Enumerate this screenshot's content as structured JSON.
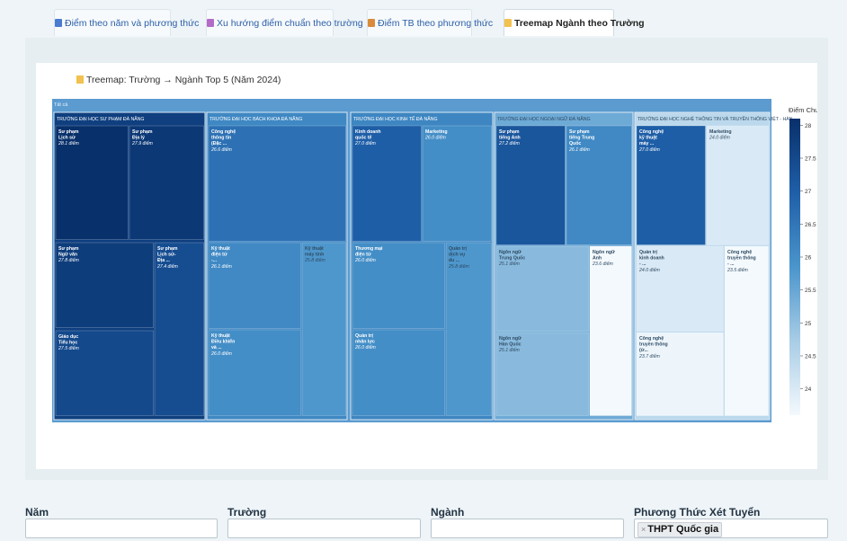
{
  "tabs": [
    {
      "label": "Điểm theo năm và phương thức",
      "icon": "calendar-icon",
      "color": "#4a7bd0"
    },
    {
      "label": "Xu hướng điểm chuẩn theo trường",
      "icon": "trend-chart-icon",
      "color": "#b46bc8"
    },
    {
      "label": "Điểm TB theo phương thức",
      "icon": "bar-chart-icon",
      "color": "#d98a3a"
    },
    {
      "label": "Treemap Ngành theo Trường",
      "icon": "folder-icon",
      "color": "#f2c14e"
    }
  ],
  "active_tab": 3,
  "chart_title": "Treemap: Trường → Ngành Top 5 (Năm 2024)",
  "chart_data": {
    "type": "treemap",
    "root_label": "Tất cả",
    "value_label": "Điểm Chuẩn",
    "colorbar": {
      "min": 23.6,
      "max": 28.1,
      "ticks": [
        28,
        27.5,
        27,
        26.5,
        26,
        25.5,
        25,
        24.5,
        24
      ]
    },
    "unit_suffix": "điểm",
    "schools": [
      {
        "name": "TRƯỜNG ĐẠI HỌC SƯ PHẠM ĐÀ NẴNG",
        "majors": [
          {
            "lines": [
              "Sư phạm",
              "Lịch sử"
            ],
            "value": 28.1
          },
          {
            "lines": [
              "Sư phạm",
              "Địa lý"
            ],
            "value": 27.9
          },
          {
            "lines": [
              "Sư phạm",
              "Ngữ văn"
            ],
            "value": 27.8
          },
          {
            "lines": [
              "Sư phạm",
              "Lịch sử-",
              "Địa ..."
            ],
            "value": 27.4
          },
          {
            "lines": [
              "Giáo dục",
              "Tiểu học"
            ],
            "value": 27.5
          }
        ]
      },
      {
        "name": "TRƯỜNG ĐẠI HỌC BÁCH KHOA ĐÀ NẴNG",
        "majors": [
          {
            "lines": [
              "Công nghệ",
              "thông tin",
              "(Đặc ..."
            ],
            "value": 26.6
          },
          {
            "lines": [
              "Kỹ thuật",
              "điện tử",
              "-..."
            ],
            "value": 26.1
          },
          {
            "lines": [
              "Kỹ thuật",
              "máy tính"
            ],
            "value": 25.8
          },
          {
            "lines": [
              "Kỹ thuật",
              "Điều khiển",
              "và ..."
            ],
            "value": 26.0
          }
        ]
      },
      {
        "name": "TRƯỜNG ĐẠI HỌC KINH TẾ ĐÀ NẴNG",
        "majors": [
          {
            "lines": [
              "Kinh doanh",
              "quốc tế"
            ],
            "value": 27.0
          },
          {
            "lines": [
              "Marketing"
            ],
            "value": 26.0
          },
          {
            "lines": [
              "Thương mại",
              "điện tử"
            ],
            "value": 26.0
          },
          {
            "lines": [
              "Quản trị",
              "dịch vụ",
              "du ..."
            ],
            "value": 25.8
          },
          {
            "lines": [
              "Quản trị",
              "nhân lực"
            ],
            "value": 26.0
          }
        ]
      },
      {
        "name": "TRƯỜNG ĐẠI HỌC NGOẠI NGỮ ĐÀ NẴNG",
        "majors": [
          {
            "lines": [
              "Sư phạm",
              "tiếng Anh"
            ],
            "value": 27.2
          },
          {
            "lines": [
              "Sư phạm",
              "tiếng Trung",
              "Quốc"
            ],
            "value": 26.1
          },
          {
            "lines": [
              "Ngôn ngữ",
              "Trung Quốc"
            ],
            "value": 25.1
          },
          {
            "lines": [
              "Ngôn ngữ",
              "Anh"
            ],
            "value": 23.6
          },
          {
            "lines": [
              "Ngôn ngữ",
              "Hàn Quốc"
            ],
            "value": 25.1
          }
        ]
      },
      {
        "name": "TRƯỜNG ĐẠI HỌC NGHỆ THÔNG TIN VÀ TRUYỀN THÔNG VIỆT - HÀN",
        "majors": [
          {
            "lines": [
              "Công nghệ",
              "kỹ thuật",
              "máy ..."
            ],
            "value": 27.0
          },
          {
            "lines": [
              "Marketing"
            ],
            "value": 24.0
          },
          {
            "lines": [
              "Quản trị",
              "kinh doanh",
              "- ..."
            ],
            "value": 24.0
          },
          {
            "lines": [
              "Công nghệ",
              "truyền thông",
              "- ..."
            ],
            "value": 23.5
          },
          {
            "lines": [
              "Công nghệ",
              "truyền thông",
              "(ứ..."
            ],
            "value": 23.7
          }
        ]
      }
    ]
  },
  "filters": [
    {
      "label": "Năm",
      "value": ""
    },
    {
      "label": "Trường",
      "value": ""
    },
    {
      "label": "Ngành",
      "value": ""
    },
    {
      "label": "Phương Thức Xét Tuyển",
      "chip": "THPT Quốc gia"
    }
  ]
}
